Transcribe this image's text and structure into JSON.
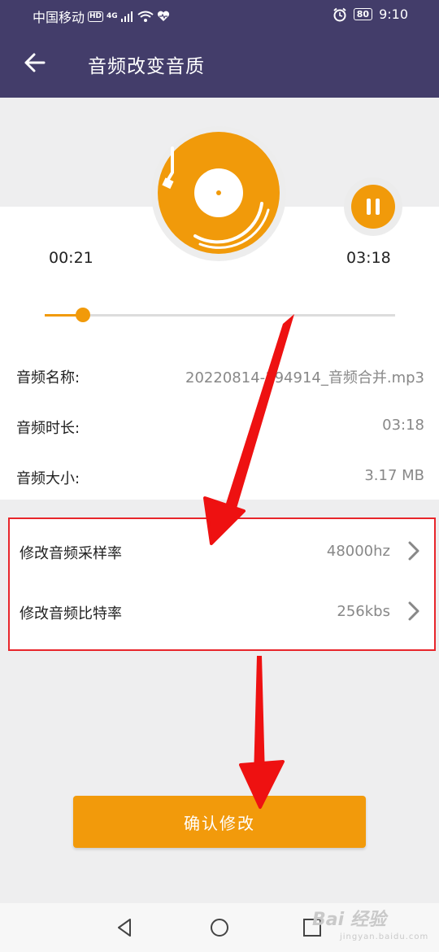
{
  "status_bar": {
    "carrier": "中国移动",
    "hd_badge": "HD",
    "network": "4G",
    "battery": "80",
    "time": "9:10"
  },
  "app_bar": {
    "title": "音频改变音质",
    "back_icon": "arrow-left-icon"
  },
  "player": {
    "current_time": "00:21",
    "total_time": "03:18",
    "progress_fraction": 0.11,
    "disc_icon": "vinyl-record-icon",
    "pause_icon": "pause-icon"
  },
  "info": [
    {
      "label": "音频名称:",
      "value": "20220814-194914_音频合并.mp3"
    },
    {
      "label": "音频时长:",
      "value": "03:18"
    },
    {
      "label": "音频大小:",
      "value": "3.17 MB"
    }
  ],
  "settings": [
    {
      "label": "修改音频采样率",
      "value": "48000hz"
    },
    {
      "label": "修改音频比特率",
      "value": "256kbs"
    }
  ],
  "confirm_button": "确认修改",
  "watermark": {
    "brand": "Bai 经验",
    "sub": "jingyan.baidu.com"
  },
  "colors": {
    "app_bar": "#433d6a",
    "accent": "#f19a0a",
    "highlight_box": "#e8262b",
    "annotation_arrow": "#ee1111"
  }
}
